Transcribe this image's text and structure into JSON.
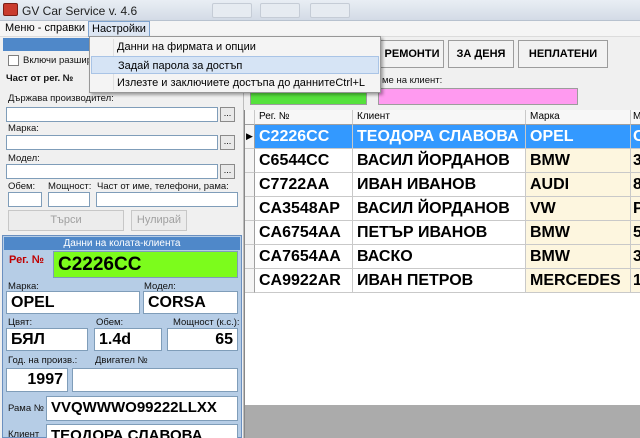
{
  "window": {
    "title": "GV Car Service v. 4.6",
    "ghost_tabs": [
      "",
      "",
      ""
    ]
  },
  "menu": {
    "items": [
      "Меню - справки",
      "Настройки"
    ],
    "dropdown": [
      {
        "label": "Данни на фирмата и опции",
        "shortcut": ""
      },
      {
        "label": "Задай парола за достъп",
        "shortcut": ""
      },
      {
        "label": "Излезте и заключиете достъпа до данните",
        "shortcut": "Ctrl+L"
      }
    ]
  },
  "search_panel": {
    "header": "Ре",
    "expand_checkbox_label": "Включи разшир",
    "reg_part_label": "Част от рег. №",
    "maker_label": "Държава производител:",
    "brand_label": "Марка:",
    "model_label": "Модел:",
    "volume_label": "Обем:",
    "power_label": "Мощност:",
    "name_part_label": "Част от име, телефони, рама:",
    "search_button": "Търси",
    "reset_button": "Нулирай",
    "browse": "..."
  },
  "toolbar": {
    "repairs": "РЕМОНТИ",
    "today": "ЗА ДЕНЯ",
    "unpaid": "НЕПЛАТЕНИ",
    "client_name_label": "ме на клиент:",
    "colors": {
      "green": "#55e13c",
      "pink": "#ff9af0"
    }
  },
  "car": {
    "header": "Данни на колата-клиента",
    "reg_label": "Рег. №",
    "reg_value": "C2226CC",
    "brand_label": "Марка:",
    "brand_value": "OPEL",
    "model_label": "Модел:",
    "model_value": "CORSA",
    "color_label": "Цвят:",
    "color_value": "БЯЛ",
    "volume_label": "Обем:",
    "volume_value": "1.4d",
    "power_label": "Мощност (к.с.):",
    "power_value": "65",
    "year_label": "Год. на произв.:",
    "year_value": "1997",
    "engine_label": "Двигател №",
    "engine_value": "",
    "frame_label": "Рама №",
    "frame_value": "VVQWWWO99222LLXX",
    "client_label": "Клиент",
    "client_value": "ТЕОДОРА СЛАВОВА",
    "reg_color": "#7cfc1c"
  },
  "grid": {
    "columns": [
      "Рег. №",
      "Клиент",
      "Марка",
      "М"
    ],
    "rows": [
      {
        "reg": "C2226CC",
        "client": "ТЕОДОРА СЛАВОВА",
        "brand": "OPEL",
        "model": "C"
      },
      {
        "reg": "C6544CC",
        "client": "ВАСИЛ ЙОРДАНОВ",
        "brand": "BMW",
        "model": "3"
      },
      {
        "reg": "C7722AA",
        "client": "ИВАН ИВАНОВ",
        "brand": "AUDI",
        "model": "8"
      },
      {
        "reg": "CA3548AP",
        "client": "ВАСИЛ ЙОРДАНОВ",
        "brand": "VW",
        "model": "P"
      },
      {
        "reg": "CA6754AA",
        "client": "ПЕТЪР ИВАНОВ",
        "brand": "BMW",
        "model": "5"
      },
      {
        "reg": "CA7654AA",
        "client": "ВАСКО",
        "brand": "BMW",
        "model": "3"
      },
      {
        "reg": "CA9922AR",
        "client": "ИВАН ПЕТРОВ",
        "brand": "MERCEDES",
        "model": "1"
      }
    ],
    "row_marker": "▶",
    "selected_index": 0
  }
}
